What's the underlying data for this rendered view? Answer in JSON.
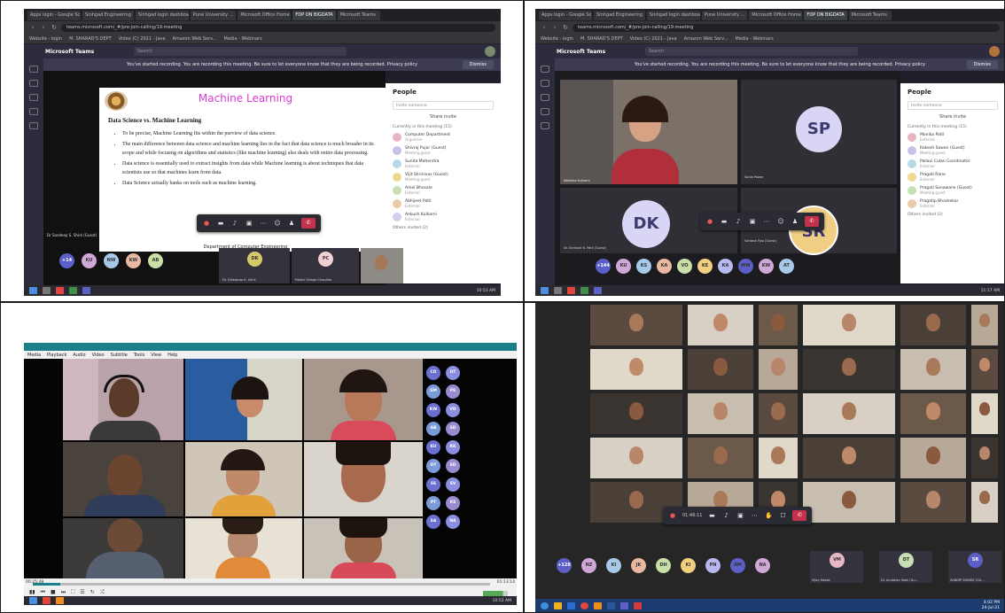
{
  "browser": {
    "tabs": [
      "Apps login - Google Sc",
      "Sinhgad Engineering",
      "Sinhgad login dashboard",
      "Pune University ...",
      "Microsoft Office Home",
      "FDP ON BIGDATA",
      "Microsoft Teams"
    ],
    "url": "teams.microsoft.com/_#/pre-join-calling/19:meeting",
    "bookmarks": [
      "Website - login",
      "M. SHARAD'S DEPT",
      "Video (C) 2021 - Java",
      "Amazon Web Serv...",
      "Media - Webinars"
    ],
    "menu_label": "Microsoft Teams",
    "search_placeholder": "Search"
  },
  "recording_banner": {
    "text": "You've started recording. You are recording this meeting. Be sure to let everyone know that they are being recorded. Privacy policy",
    "dismiss": "Dismiss"
  },
  "people_panel": {
    "title": "People",
    "invite_placeholder": "Invite someone",
    "share_invite": "Share invite",
    "section_q1": "Currently in this meeting (15)",
    "section_q2": "Currently in this meeting (15)",
    "mute_all": "Mute all",
    "participants_q1": [
      {
        "name": "Computer Department",
        "role": "Organizer"
      },
      {
        "name": "Shivraj Pujar (Guest)",
        "role": "Meeting guest"
      },
      {
        "name": "Sunita Mahendra",
        "role": "External"
      },
      {
        "name": "Vijit Shrinivas (Guest)",
        "role": "Meeting guest"
      },
      {
        "name": "Amol Bhosale",
        "role": "External"
      },
      {
        "name": "Abhijeet Patil",
        "role": "External"
      },
      {
        "name": "Ankush Kulkarni",
        "role": "External"
      }
    ],
    "participants_q2": [
      {
        "name": "Monika Patil",
        "role": "External"
      },
      {
        "name": "Rakesh Sawan (Guest)",
        "role": "Meeting guest"
      },
      {
        "name": "Pallavi Culan Coordinator",
        "role": "External"
      },
      {
        "name": "Pragati Rane",
        "role": "External"
      },
      {
        "name": "Pragati Sonawane (Guest)",
        "role": "Meeting guest"
      },
      {
        "name": "Pragatip Bhadrekar",
        "role": "External"
      }
    ],
    "others_invited": "Others invited (2)"
  },
  "slide": {
    "title": "Machine Learning",
    "heading": "Data Science vs. Machine Learning",
    "bullets": [
      "To be precise, Machine Learning fits within the purview of data science.",
      "The main difference between data science and machine learning lies in the fact that data science is much broader in its scope and while focusing on algorithms and statistics (like machine learning) also deals with entire data processing.",
      "Data science is essentially used to extract insights from data while Machine learning is about techniques that data scientists use so that machines learn from data.",
      "Data Science actually banks on tools such as machine learning."
    ],
    "footer": "Department of Computer Engineering",
    "presenter_label": "Dr Sandeep S. Shirk (Guest)"
  },
  "call_controls": {
    "time_q4": "01:46:11",
    "leave_label": "✆"
  },
  "strips": {
    "q1": [
      "+14",
      "KU",
      "NW",
      "KW",
      "AB"
    ],
    "q1_named": [
      {
        "initials": "DK",
        "name": "Dr. Dinkarrao K. Shirk"
      },
      {
        "initials": "PC",
        "name": "Pallavi Shinge Chaudha"
      }
    ],
    "q2": [
      "+144",
      "KU",
      "KS",
      "KA",
      "VO",
      "KE",
      "KA",
      "MW",
      "KW",
      "AT"
    ],
    "q4": [
      "+128",
      "NZ",
      "KI",
      "JK",
      "DH",
      "KI",
      "PN",
      "AM",
      "NA"
    ],
    "q4_named": [
      {
        "initials": "VM",
        "name": "Vijay Maske"
      },
      {
        "initials": "DT",
        "name": "Dr. Anubhav Saini (Gu..."
      },
      {
        "initials": "SR",
        "name": "SANDIP SHINDE (GU..."
      }
    ]
  },
  "q2_tiles": {
    "sp": "SP",
    "sp_name": "Sonia Pawar",
    "dk": "DK",
    "dk_name": "Dr. Shrikant K. Patil (Guest)",
    "sr": "SR",
    "sr_name": "Santosh Rao (Guest)",
    "video_name": "Neelima Kulkarni"
  },
  "vlc": {
    "menu": [
      "Media",
      "Playback",
      "Audio",
      "Video",
      "Subtitle",
      "Tools",
      "View",
      "Help"
    ],
    "time_left": "00:25:48",
    "time_right": "01:13:14",
    "side_bubbles": [
      "CD",
      "DT",
      "SM",
      "PS",
      "KW",
      "VD",
      "AB",
      "SD",
      "KU",
      "RK",
      "DT",
      "SD",
      "SS",
      "SV",
      "PT",
      "RS",
      "SA",
      "NA"
    ]
  },
  "taskbar": {
    "clock_q1": "10:53 AM",
    "clock_q2": "11:17 AM",
    "clock_q3": "10:52 AM",
    "clock_q4_time": "4:02 PM",
    "clock_q4_date": "24-Jul-21"
  },
  "colors": {
    "teams_purple": "#5b5fc7",
    "teams_dark": "#2d2c3e",
    "leave_red": "#c4314b",
    "slide_title": "#d63ad6"
  }
}
